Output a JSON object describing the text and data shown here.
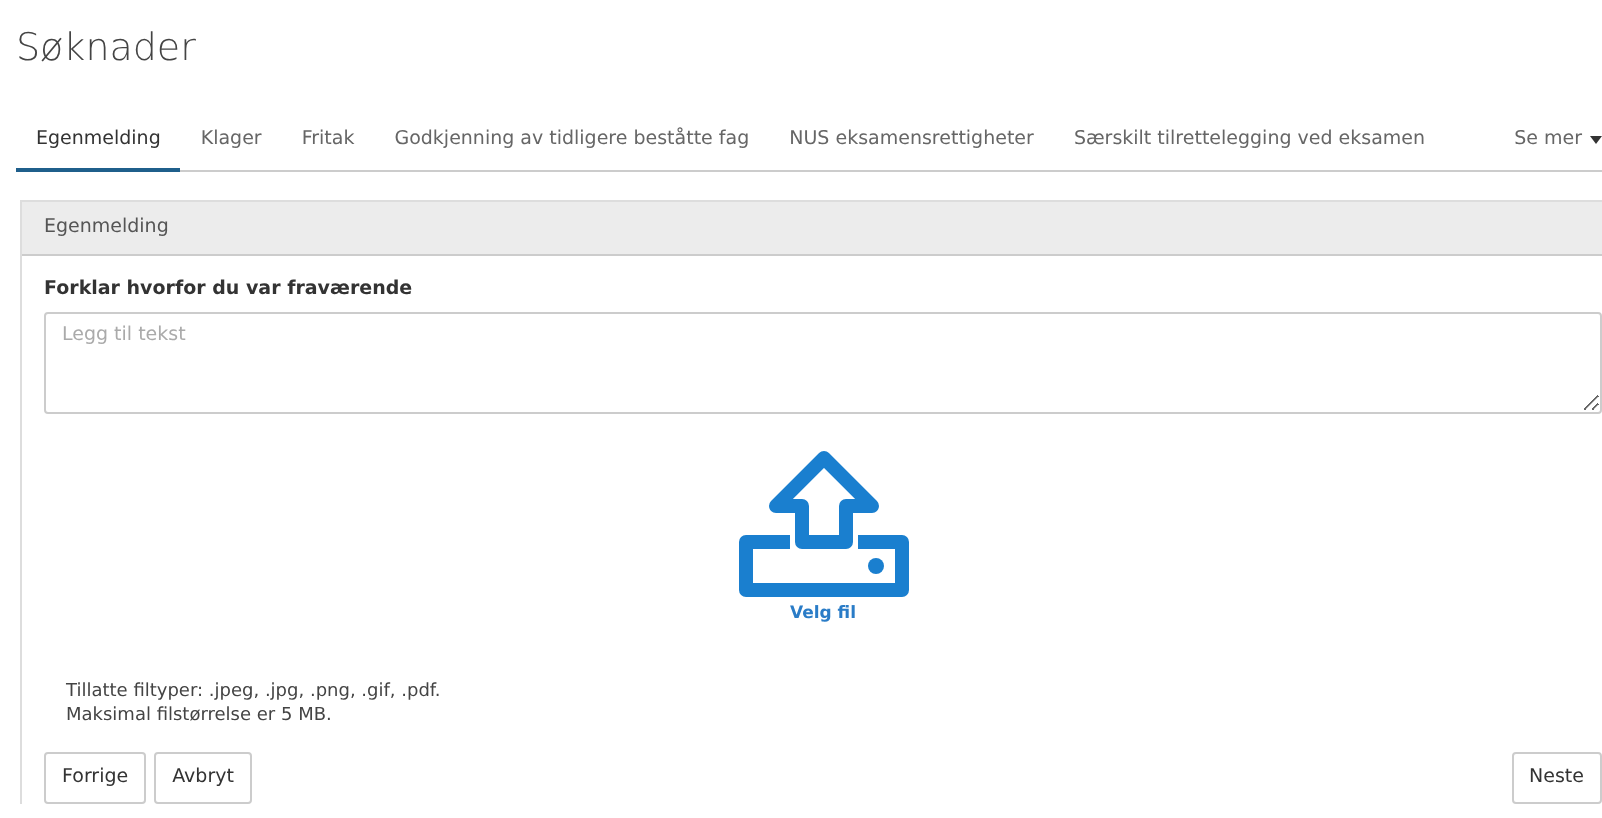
{
  "page_title": "Søknader",
  "tabs": [
    {
      "label": "Egenmelding",
      "selected": true
    },
    {
      "label": "Klager",
      "selected": false
    },
    {
      "label": "Fritak",
      "selected": false
    },
    {
      "label": "Godkjenning av tidligere beståtte fag",
      "selected": false
    },
    {
      "label": "NUS eksamensrettigheter",
      "selected": false
    },
    {
      "label": "Særskilt tilrettelegging ved eksamen",
      "selected": false
    }
  ],
  "more_tab": {
    "label": "Se mer"
  },
  "panel": {
    "header": "Egenmelding",
    "field_label": "Forklar hvorfor du var fraværende",
    "placeholder": "Legg til tekst",
    "upload_label": "Velg fil",
    "info": [
      "Tillatte filtyper: .jpeg, .jpg, .png, .gif, .pdf.",
      "Maksimal filstørrelse er 5 MB."
    ]
  },
  "buttons_left": [
    "Forrige",
    "Avbryt"
  ],
  "buttons_right": [
    "Neste"
  ]
}
